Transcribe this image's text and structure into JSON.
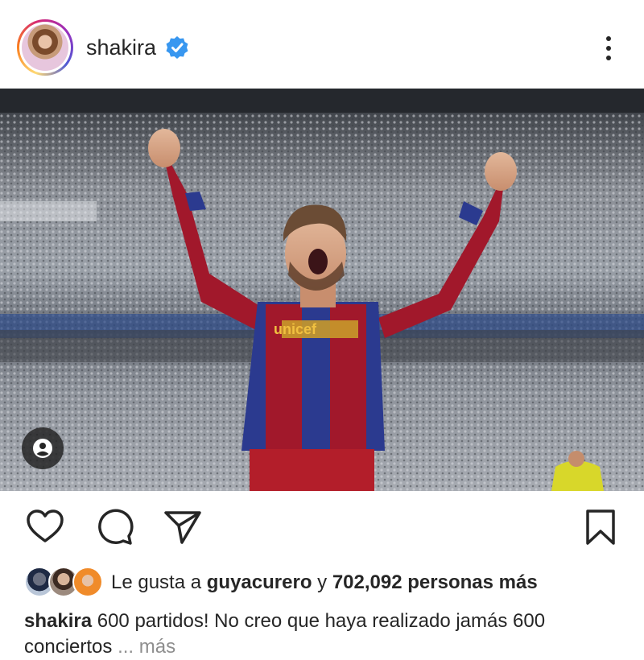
{
  "post": {
    "author": "shakira",
    "verified": true,
    "caption_user": "shakira",
    "caption_text": "600 partidos! No creo que haya realizado jamás 600",
    "caption_text_line2": "conciertos",
    "caption_more": "... más"
  },
  "likes": {
    "prefix": "Le gusta a ",
    "user": "guyacurero",
    "conjunction": " y ",
    "count": "702,092",
    "suffix": " personas más"
  },
  "photo": {
    "jersey_text": "unicef"
  },
  "colors": {
    "verified_blue": "#3897f0",
    "text": "#262626",
    "muted": "#8e8e8e",
    "jersey_red": "#a1182b",
    "jersey_blue": "#2b3a8f"
  },
  "icons": [
    "more-icon",
    "verified-icon",
    "user-tag-icon",
    "heart-icon",
    "comment-icon",
    "share-icon",
    "bookmark-icon"
  ]
}
